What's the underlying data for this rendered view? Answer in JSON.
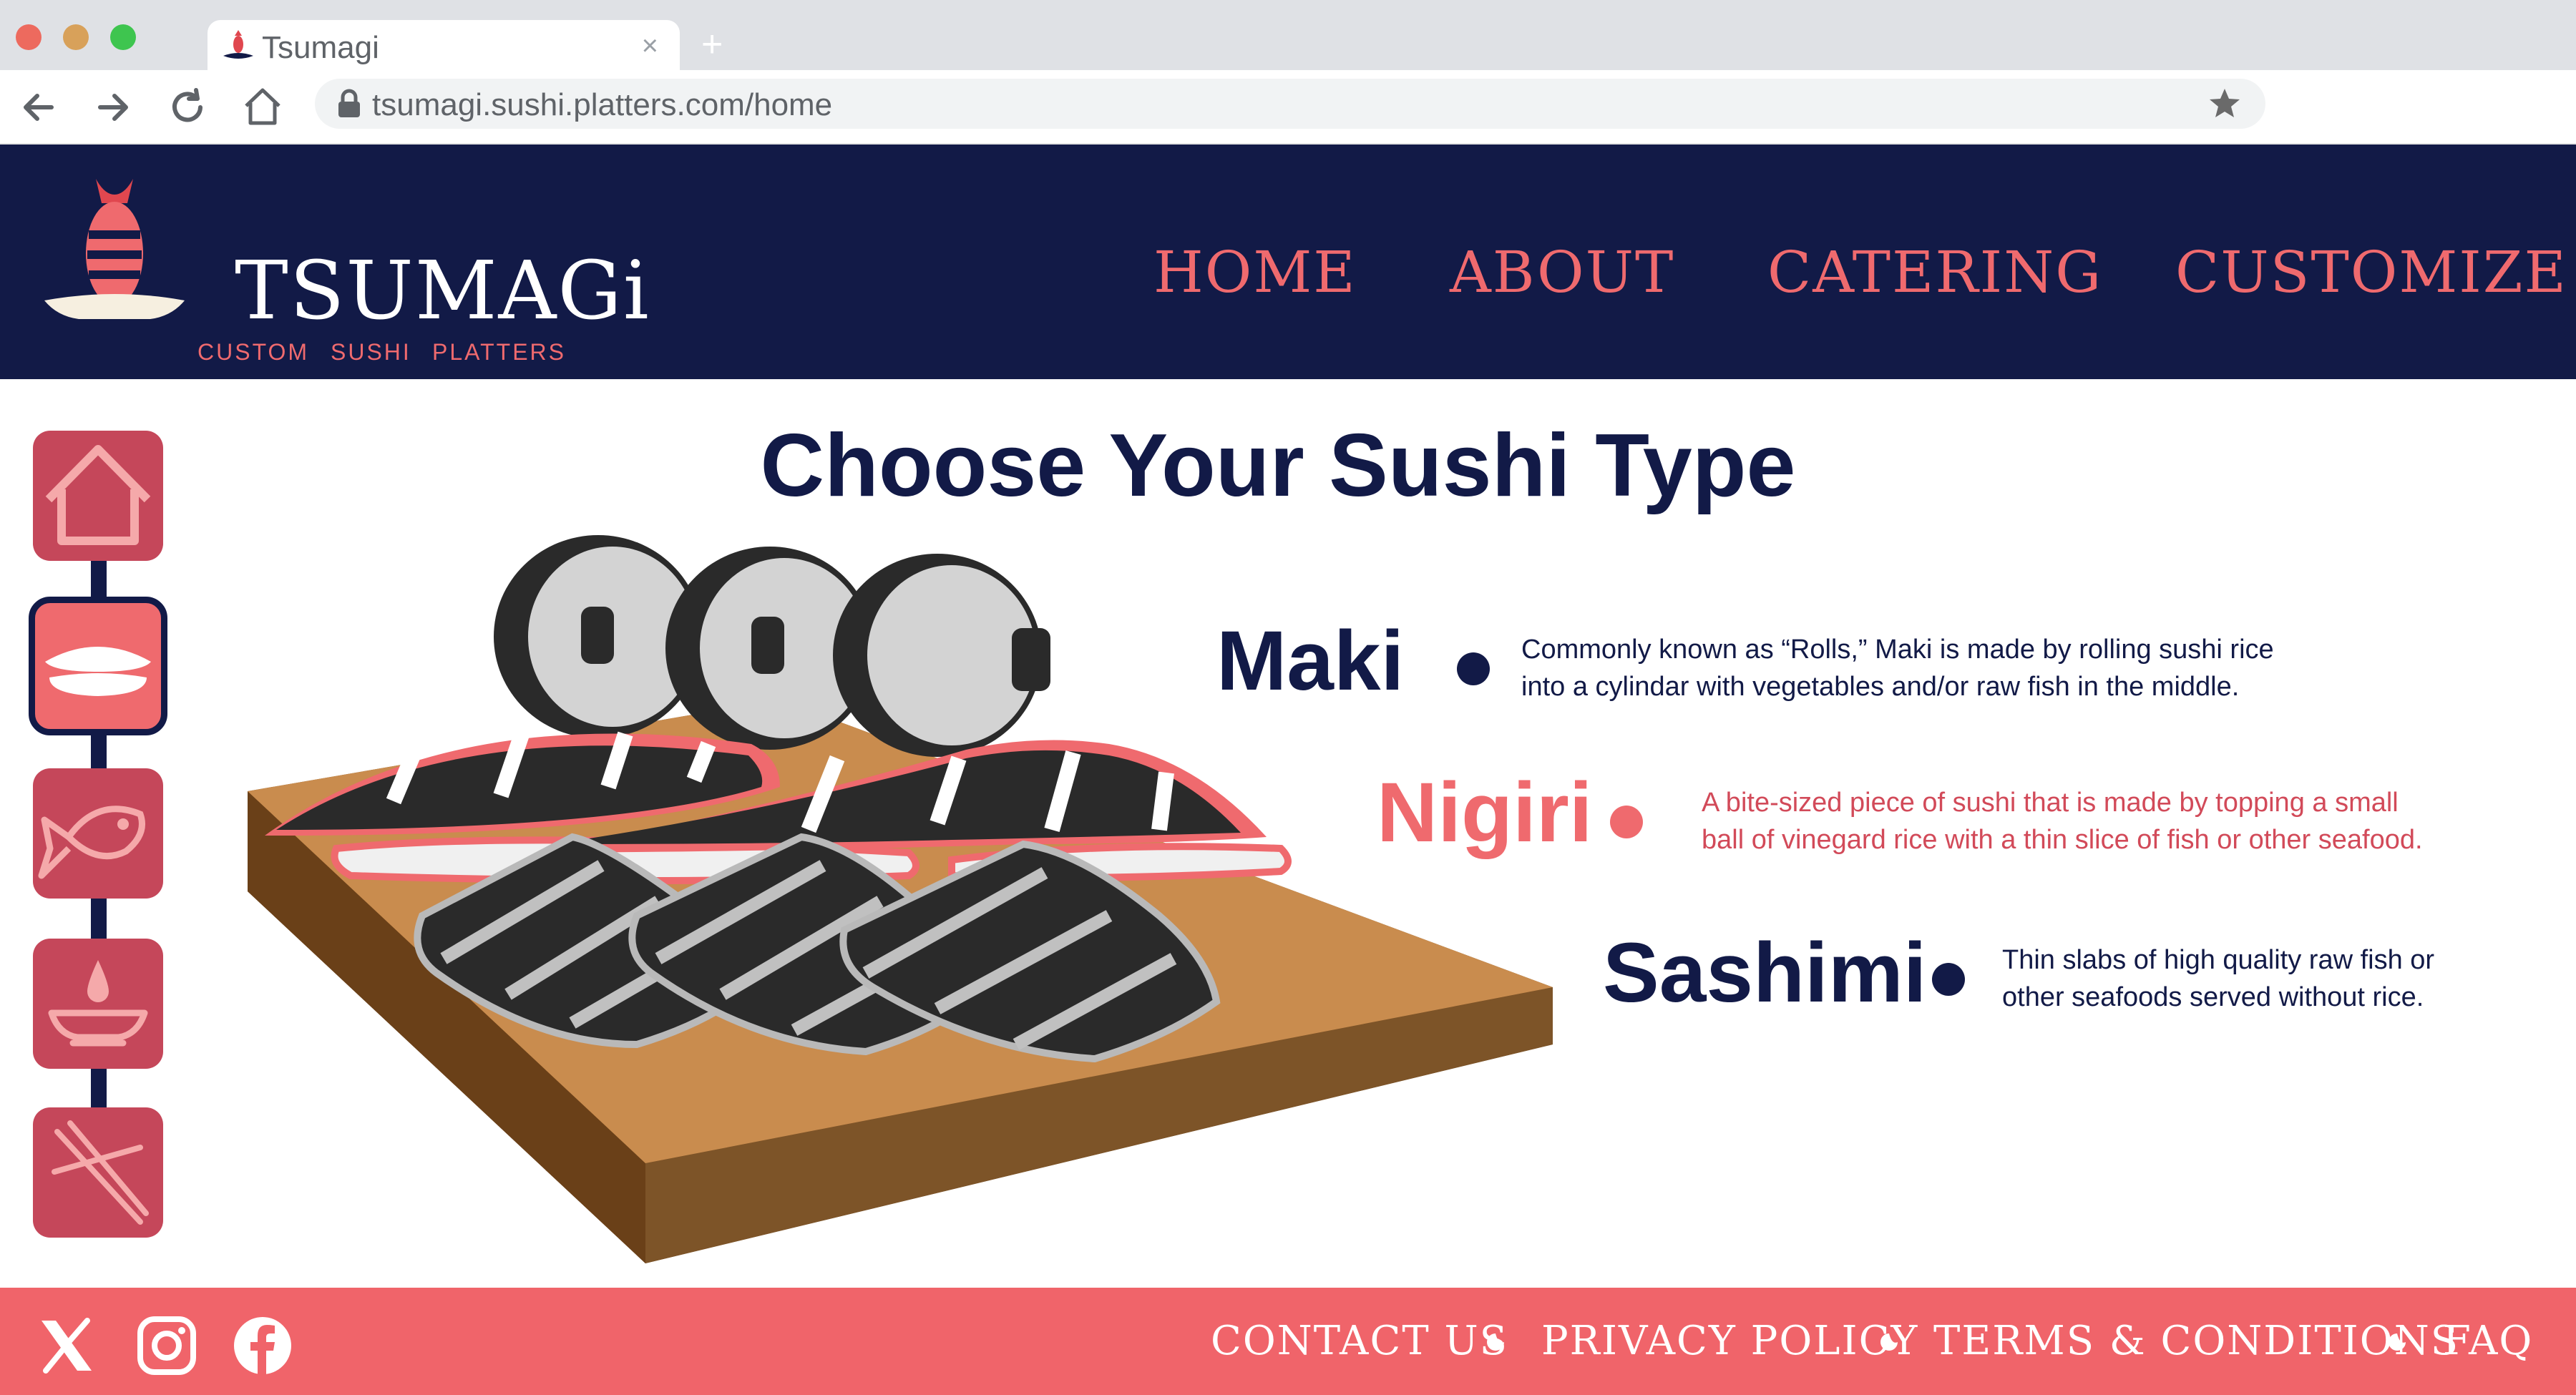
{
  "browser": {
    "tab_title": "Tsumagi",
    "tab_close": "×",
    "new_tab": "+",
    "url": "tsumagi.sushi.platters.com/home"
  },
  "brand": {
    "name": "TSUMAGi",
    "tagline_1": "CUSTOM",
    "tagline_2": "SUSHI",
    "tagline_3": "PLATTERS"
  },
  "nav": {
    "home": "HOME",
    "about": "ABOUT",
    "catering": "CATERING",
    "customize": "CUSTOMIZE"
  },
  "sidebar": {
    "items": [
      {
        "icon": "house-icon",
        "active": false
      },
      {
        "icon": "nigiri-icon",
        "active": true
      },
      {
        "icon": "fish-icon",
        "active": false
      },
      {
        "icon": "soy-sauce-icon",
        "active": false
      },
      {
        "icon": "chopsticks-icon",
        "active": false
      }
    ]
  },
  "main": {
    "title": "Choose Your Sushi Type",
    "types": [
      {
        "name": "Maki",
        "line1": "Commonly known as “Rolls,” Maki is made by rolling sushi rice",
        "line2": "into a cylindar with vegetables and/or raw fish in the middle.",
        "active": false
      },
      {
        "name": "Nigiri",
        "line1": "A bite-sized piece of sushi that is made by topping a small",
        "line2": "ball of vinegard rice with a thin slice of fish or other seafood.",
        "active": true
      },
      {
        "name": "Sashimi",
        "line1": "Thin slabs of high quality raw fish or",
        "line2": "other seafoods served without rice.",
        "active": false
      }
    ]
  },
  "footer": {
    "contact": "CONTACT US",
    "privacy": "PRIVACY POLICY",
    "terms": "TERMS & CONDITIONS",
    "faq": "FAQ",
    "social": [
      "x-icon",
      "instagram-icon",
      "facebook-icon"
    ]
  },
  "colors": {
    "navy": "#121a47",
    "coral": "#ef6a6e",
    "rose": "#c5475a",
    "wood": "#c98c4e"
  }
}
